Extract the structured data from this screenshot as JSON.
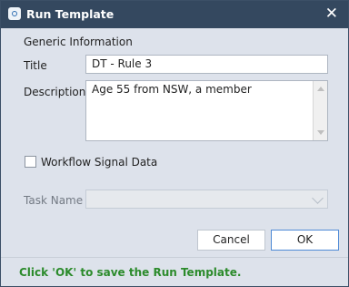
{
  "window": {
    "title": "Run Template",
    "icons": [
      "app-icon",
      "close-icon"
    ],
    "close_glyph": "✕"
  },
  "form": {
    "section_title": "Generic Information",
    "title_label": "Title",
    "title_value": "DT - Rule 3",
    "description_label": "Description",
    "description_value": "Age 55 from NSW, a member",
    "workflow_label": "Workflow Signal Data",
    "workflow_checked": false,
    "task_name_label": "Task Name",
    "task_name_value": ""
  },
  "buttons": {
    "cancel": "Cancel",
    "ok": "OK"
  },
  "footer": {
    "message": "Click 'OK' to save the Run Template."
  },
  "colors": {
    "titlebar": "#34485f",
    "dialog_bg": "#dde2eb",
    "message": "#2c8b2c",
    "ok_border": "#4f8ad6"
  }
}
